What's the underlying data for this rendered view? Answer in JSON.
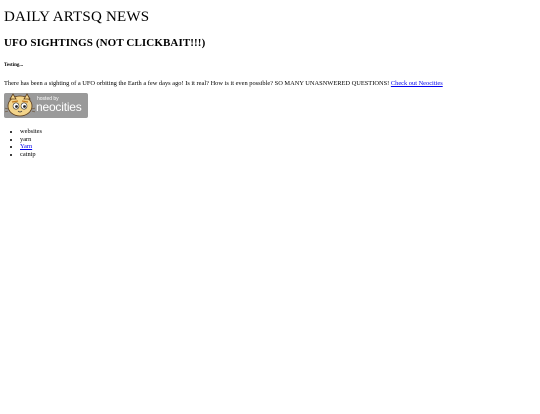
{
  "site_title": "DAILY ARTSQ NEWS",
  "headline": "UFO SIGHTINGS (NOT CLICKBAIT!!!)",
  "subhead": "Testing...",
  "article": {
    "text": "There has been a sighting of a UFO orbiting the Earth a few days ago! Is it real? How is it even possible? SO MANY UNASNWERED QUESTIONS!",
    "link_text": "Check out Neocities"
  },
  "badge": {
    "hosted_by": "hosted by",
    "brand": "neocities",
    "icon": "neocities-cat-icon"
  },
  "links": [
    {
      "label": "websites",
      "is_link": false
    },
    {
      "label": "yarn",
      "is_link": false
    },
    {
      "label": "Yarn",
      "is_link": true
    },
    {
      "label": "catnip",
      "is_link": false
    }
  ],
  "colors": {
    "link": "#0000ee",
    "badge_bg": "#9a9a9a",
    "text": "#000000"
  }
}
